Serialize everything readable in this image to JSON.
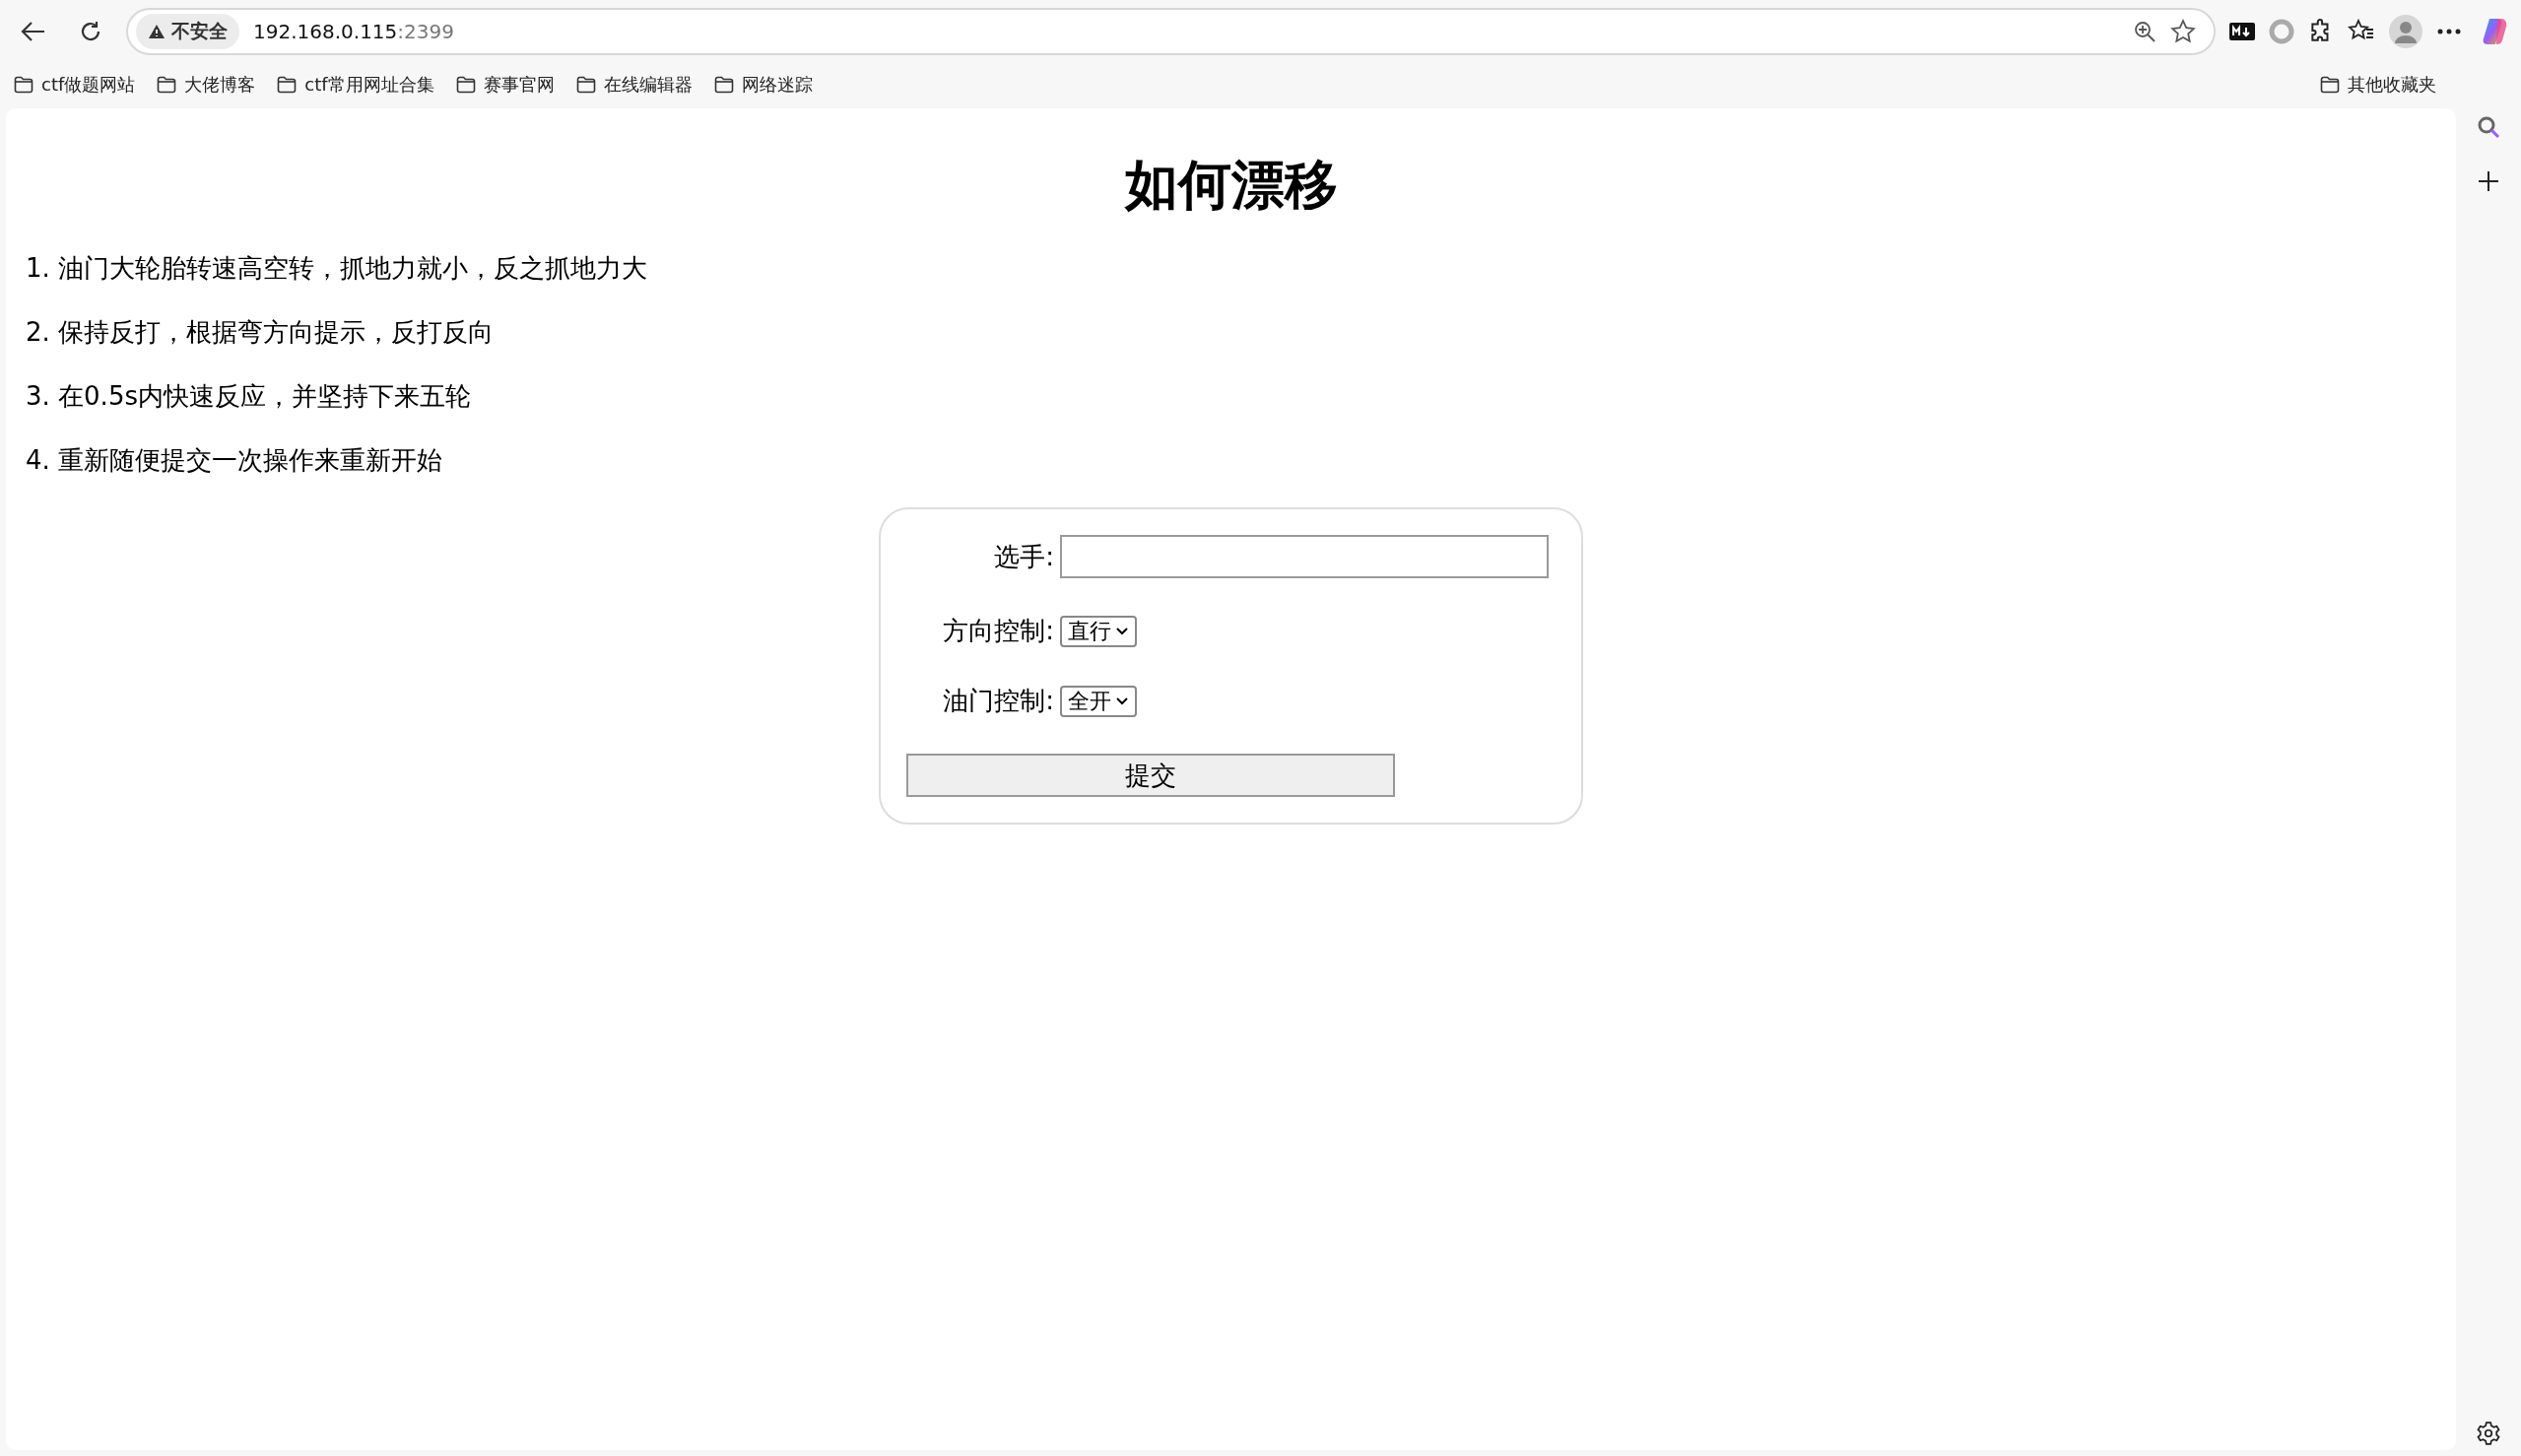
{
  "browser": {
    "security_label": "不安全",
    "url_host": "192.168.0.115",
    "url_port": ":2399",
    "bookmarks": [
      "ctf做题网站",
      "大佬博客",
      "ctf常用网址合集",
      "赛事官网",
      "在线编辑器",
      "网络迷踪"
    ],
    "other_bookmarks": "其他收藏夹"
  },
  "page": {
    "title": "如何漂移",
    "steps": [
      "1. 油门大轮胎转速高空转，抓地力就小，反之抓地力大",
      "2. 保持反打，根据弯方向提示，反打反向",
      "3. 在0.5s内快速反应，并坚持下来五轮",
      "4. 重新随便提交一次操作来重新开始"
    ],
    "form": {
      "fields": [
        {
          "kind": "text",
          "label": "选手:"
        },
        {
          "kind": "select",
          "label": "方向控制:",
          "value": "直行"
        },
        {
          "kind": "select",
          "label": "油门控制:",
          "value": "全开"
        }
      ],
      "submit": "提交"
    }
  }
}
